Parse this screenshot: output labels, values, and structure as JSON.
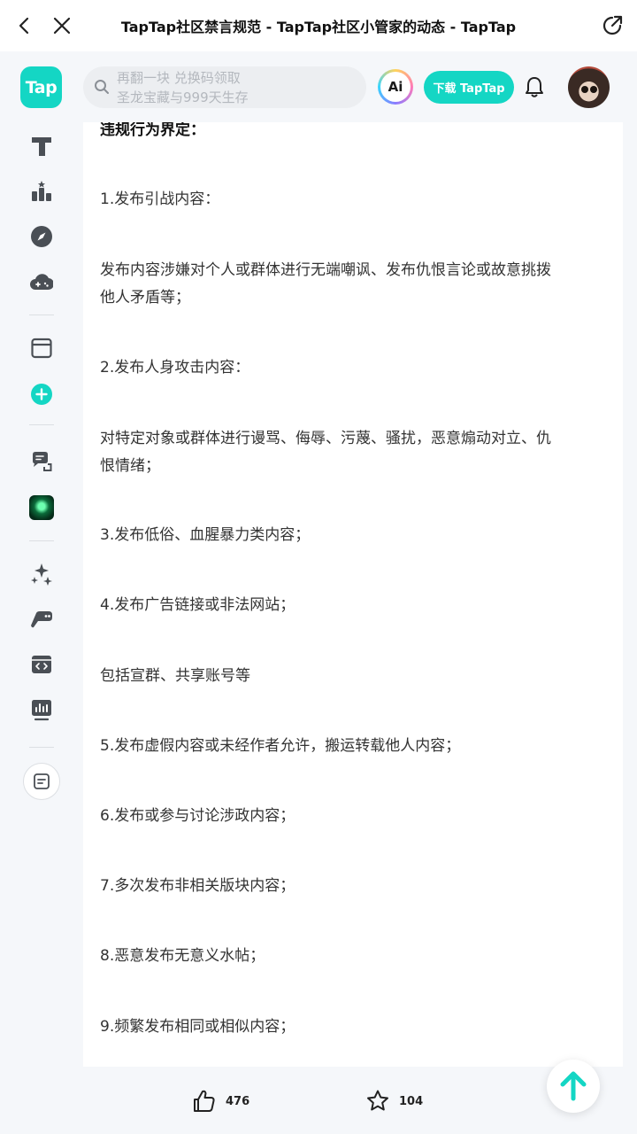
{
  "browser": {
    "title": "TapTap社区禁言规范 - TapTap社区小管家的动态 - TapTap",
    "icons": {
      "back": "chevron-left-icon",
      "close": "close-icon",
      "share": "share-icon"
    }
  },
  "header": {
    "logo_text": "Tap",
    "search_placeholder_line1": "再翻一块 兑换码领取",
    "search_placeholder_line2": "圣龙宝藏与999天生存",
    "ai_label": "Ai",
    "download_label": "下载 TapTap",
    "accent_color": "#14d6c4"
  },
  "rail": {
    "items": [
      "home-icon",
      "ranking-icon",
      "explore-icon",
      "cloud-game-icon",
      "window-icon",
      "add-icon",
      "chat-icon",
      "game-thumbnail",
      "sparkle-icon",
      "controller-icon",
      "dev-icon",
      "stats-icon",
      "notes-icon"
    ]
  },
  "article": {
    "lines": [
      "违规行为界定：",
      "1.发布引战内容：",
      "发布内容涉嫌对个人或群体进行无端嘲讽、发布仇恨言论或故意挑拨",
      "他人矛盾等；",
      "2.发布人身攻击内容：",
      "对特定对象或群体进行谩骂、侮辱、污蔑、骚扰，恶意煽动对立、仇",
      "恨情绪；",
      "3.发布低俗、血腥暴力类内容；",
      "4.发布广告链接或非法网站；",
      "包括宣群、共享账号等",
      "5.发布虚假内容或未经作者允许，搬运转载他人内容；",
      "6.发布或参与讨论涉政内容；",
      "7.多次发布非相关版块内容；",
      "8.恶意发布无意义水帖；",
      "9.频繁发布相同或相似内容；"
    ]
  },
  "actions": {
    "like_count": "476",
    "favorite_count": "104"
  }
}
